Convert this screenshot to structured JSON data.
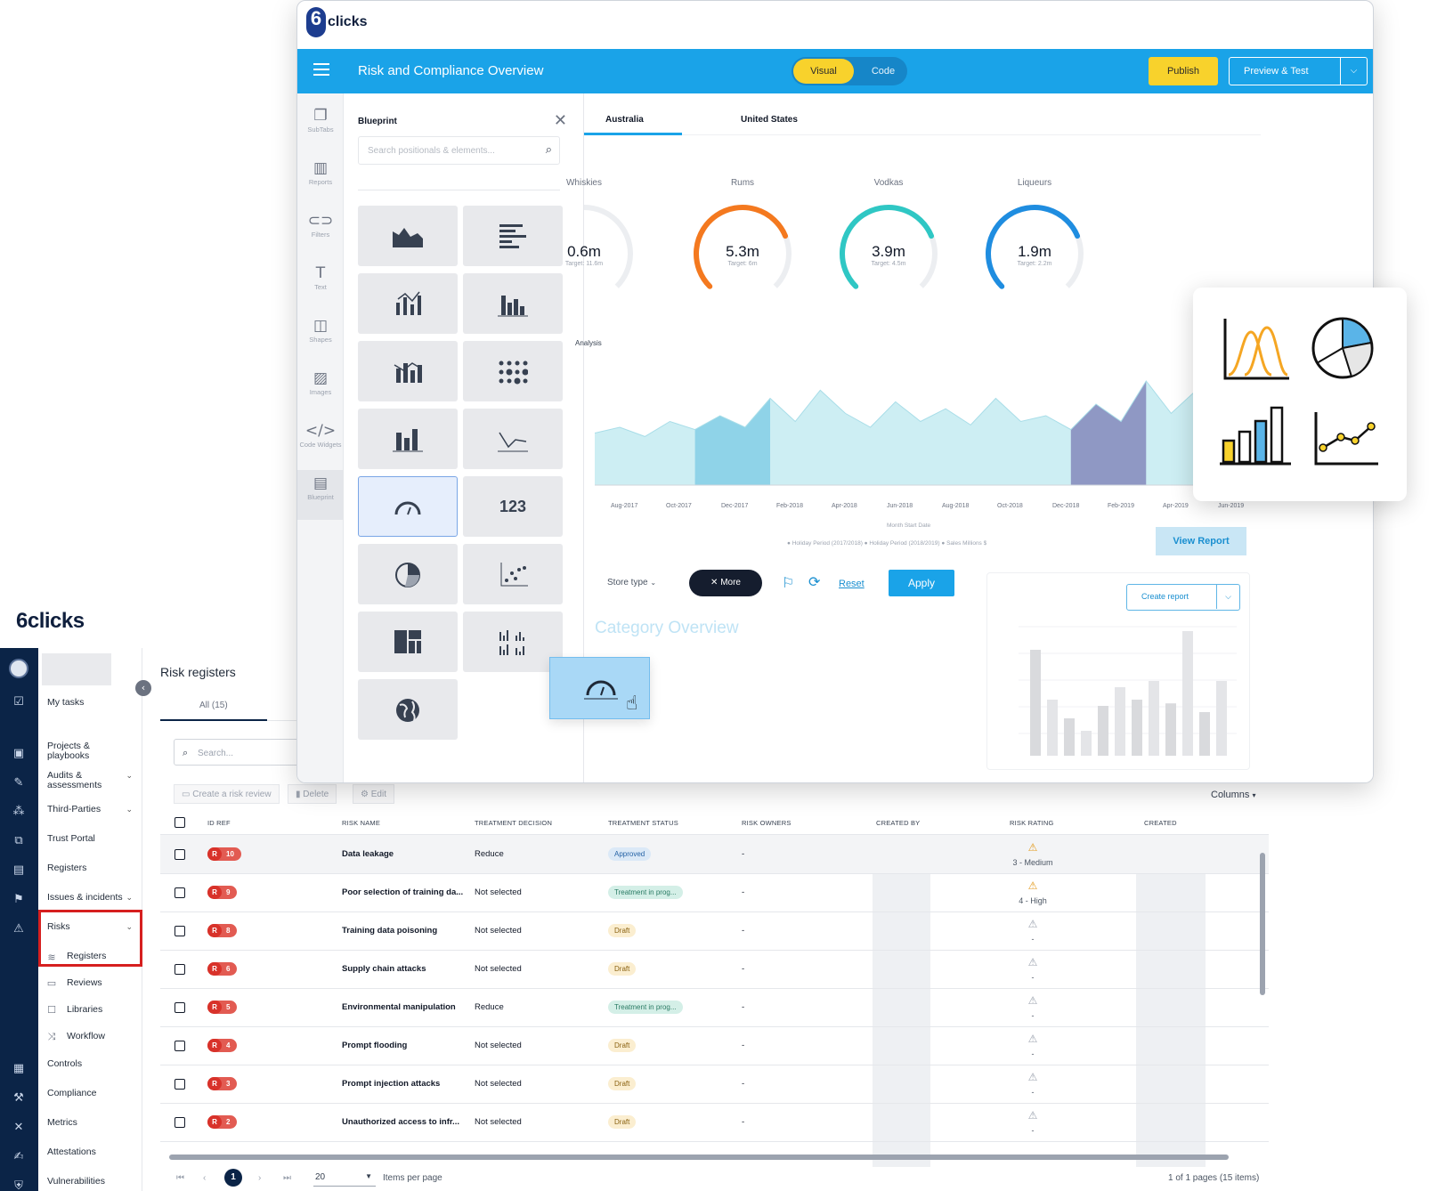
{
  "bottom_app": {
    "logo": "6clicks",
    "nav": {
      "my_tasks": "My tasks",
      "items": [
        {
          "label": "Projects & playbooks",
          "chevron": false
        },
        {
          "label": "Audits & assessments",
          "chevron": true
        },
        {
          "label": "Third-Parties",
          "chevron": true
        },
        {
          "label": "Trust Portal",
          "chevron": false
        },
        {
          "label": "Registers",
          "chevron": false
        },
        {
          "label": "Issues & incidents",
          "chevron": true
        },
        {
          "label": "Risks",
          "chevron": true
        }
      ],
      "risk_sub": [
        "Registers",
        "Reviews",
        "Libraries",
        "Workflow"
      ],
      "bottom_items": [
        "Controls",
        "Compliance",
        "Metrics",
        "Attestations",
        "Vulnerabilities"
      ]
    },
    "page_title": "Risk registers",
    "tab_all": "All (15)",
    "search_placeholder": "Search...",
    "toolbar": {
      "create": "Create a risk review",
      "delete": "Delete",
      "edit": "Edit",
      "columns": "Columns"
    },
    "columns": [
      "ID REF",
      "RISK NAME",
      "TREATMENT DECISION",
      "TREATMENT STATUS",
      "RISK OWNERS",
      "CREATED BY",
      "RISK RATING",
      "CREATED"
    ],
    "rows": [
      {
        "id": "10",
        "name": "Data leakage",
        "decision": "Reduce",
        "status": "Approved",
        "status_kind": "approved",
        "owners": "-",
        "rating": "3 - Medium",
        "rating_kind": "warn"
      },
      {
        "id": "9",
        "name": "Poor selection of training da...",
        "decision": "Not selected",
        "status": "Treatment in prog...",
        "status_kind": "progress",
        "owners": "-",
        "rating": "4 - High",
        "rating_kind": "warn"
      },
      {
        "id": "8",
        "name": "Training data poisoning",
        "decision": "Not selected",
        "status": "Draft",
        "status_kind": "draft",
        "owners": "-",
        "rating": "-",
        "rating_kind": "blank"
      },
      {
        "id": "6",
        "name": "Supply chain attacks",
        "decision": "Not selected",
        "status": "Draft",
        "status_kind": "draft",
        "owners": "-",
        "rating": "-",
        "rating_kind": "blank"
      },
      {
        "id": "5",
        "name": "Environmental manipulation",
        "decision": "Reduce",
        "status": "Treatment in prog...",
        "status_kind": "progress",
        "owners": "-",
        "rating": "-",
        "rating_kind": "blank"
      },
      {
        "id": "4",
        "name": "Prompt flooding",
        "decision": "Not selected",
        "status": "Draft",
        "status_kind": "draft",
        "owners": "-",
        "rating": "-",
        "rating_kind": "blank"
      },
      {
        "id": "3",
        "name": "Prompt injection attacks",
        "decision": "Not selected",
        "status": "Draft",
        "status_kind": "draft",
        "owners": "-",
        "rating": "-",
        "rating_kind": "blank"
      },
      {
        "id": "2",
        "name": "Unauthorized access to infr...",
        "decision": "Not selected",
        "status": "Draft",
        "status_kind": "draft",
        "owners": "-",
        "rating": "-",
        "rating_kind": "blank"
      }
    ],
    "id_prefix": "R",
    "pagination": {
      "current": "1",
      "page_size": "20",
      "items_per_page_label": "Items per page",
      "summary": "1 of 1 pages (15 items)"
    }
  },
  "builder": {
    "logo": "clicks",
    "title": "Risk and Compliance Overview",
    "toggle": {
      "visual": "Visual",
      "code": "Code"
    },
    "publish": "Publish",
    "preview": "Preview & Test",
    "tools": [
      {
        "icon": "subtabs-icon",
        "glyph": "❐",
        "label": "SubTabs"
      },
      {
        "icon": "reports-icon",
        "glyph": "▥",
        "label": "Reports"
      },
      {
        "icon": "filters-icon",
        "glyph": "⊂⊃",
        "label": "Filters"
      },
      {
        "icon": "text-icon",
        "glyph": "T",
        "label": "Text"
      },
      {
        "icon": "shapes-icon",
        "glyph": "◫",
        "label": "Shapes"
      },
      {
        "icon": "images-icon",
        "glyph": "▨",
        "label": "Images"
      },
      {
        "icon": "code-widgets-icon",
        "glyph": "</>",
        "label": "Code Widgets"
      },
      {
        "icon": "blueprint-icon",
        "glyph": "▤",
        "label": "Blueprint"
      }
    ],
    "blueprint": {
      "title": "Blueprint",
      "search_placeholder": "Search positionals & elements...",
      "number_tile": "123"
    },
    "tabs": [
      "Australia",
      "United States"
    ],
    "gauges": [
      {
        "label": "Whiskies",
        "value": "0.6m",
        "target": "Target: 11.6m",
        "color": "#e53935",
        "level": 0.45
      },
      {
        "label": "Rums",
        "value": "5.3m",
        "target": "Target: 6m",
        "color": "#f4791f",
        "level": 0.75
      },
      {
        "label": "Vodkas",
        "value": "3.9m",
        "target": "Target: 4.5m",
        "color": "#2fc7c4",
        "level": 0.75
      },
      {
        "label": "Liqueurs",
        "value": "1.9m",
        "target": "Target: 2.2m",
        "color": "#1f8de0",
        "level": 0.75
      }
    ],
    "analysis_label": "Analysis",
    "area_chart": {
      "x_ticks": [
        "Aug-2017",
        "Oct-2017",
        "Dec-2017",
        "Feb-2018",
        "Apr-2018",
        "Jun-2018",
        "Aug-2018",
        "Oct-2018",
        "Dec-2018",
        "Feb-2019",
        "Apr-2019",
        "Jun-2019"
      ],
      "x_title": "Month Start Date",
      "legend": "● Holiday Period (2017/2018)  ● Holiday Period (2018/2019)  ● Sales Millions $",
      "values": [
        0.45,
        0.5,
        0.42,
        0.55,
        0.48,
        0.6,
        0.5,
        0.75,
        0.55,
        0.82,
        0.62,
        0.5,
        0.72,
        0.55,
        0.66,
        0.52,
        0.75,
        0.55,
        0.6,
        0.48,
        0.7,
        0.55,
        0.9,
        0.62,
        0.82,
        0.58,
        0.6,
        0.65
      ]
    },
    "view_report": "View Report",
    "filters": {
      "store_type": "Store type",
      "more": "More",
      "reset": "Reset",
      "apply": "Apply"
    },
    "category_title": "Category Overview",
    "create_report": "Create report",
    "mini_bars": [
      0.85,
      0.45,
      0.3,
      0.2,
      0.4,
      0.55,
      0.45,
      0.6,
      0.42,
      1.0,
      0.35,
      0.6
    ]
  },
  "colors": {
    "brand_blue": "#1aa3e8",
    "navy": "#0b2447",
    "accent_yellow": "#f8d22c",
    "risk_red": "#d8322a"
  }
}
